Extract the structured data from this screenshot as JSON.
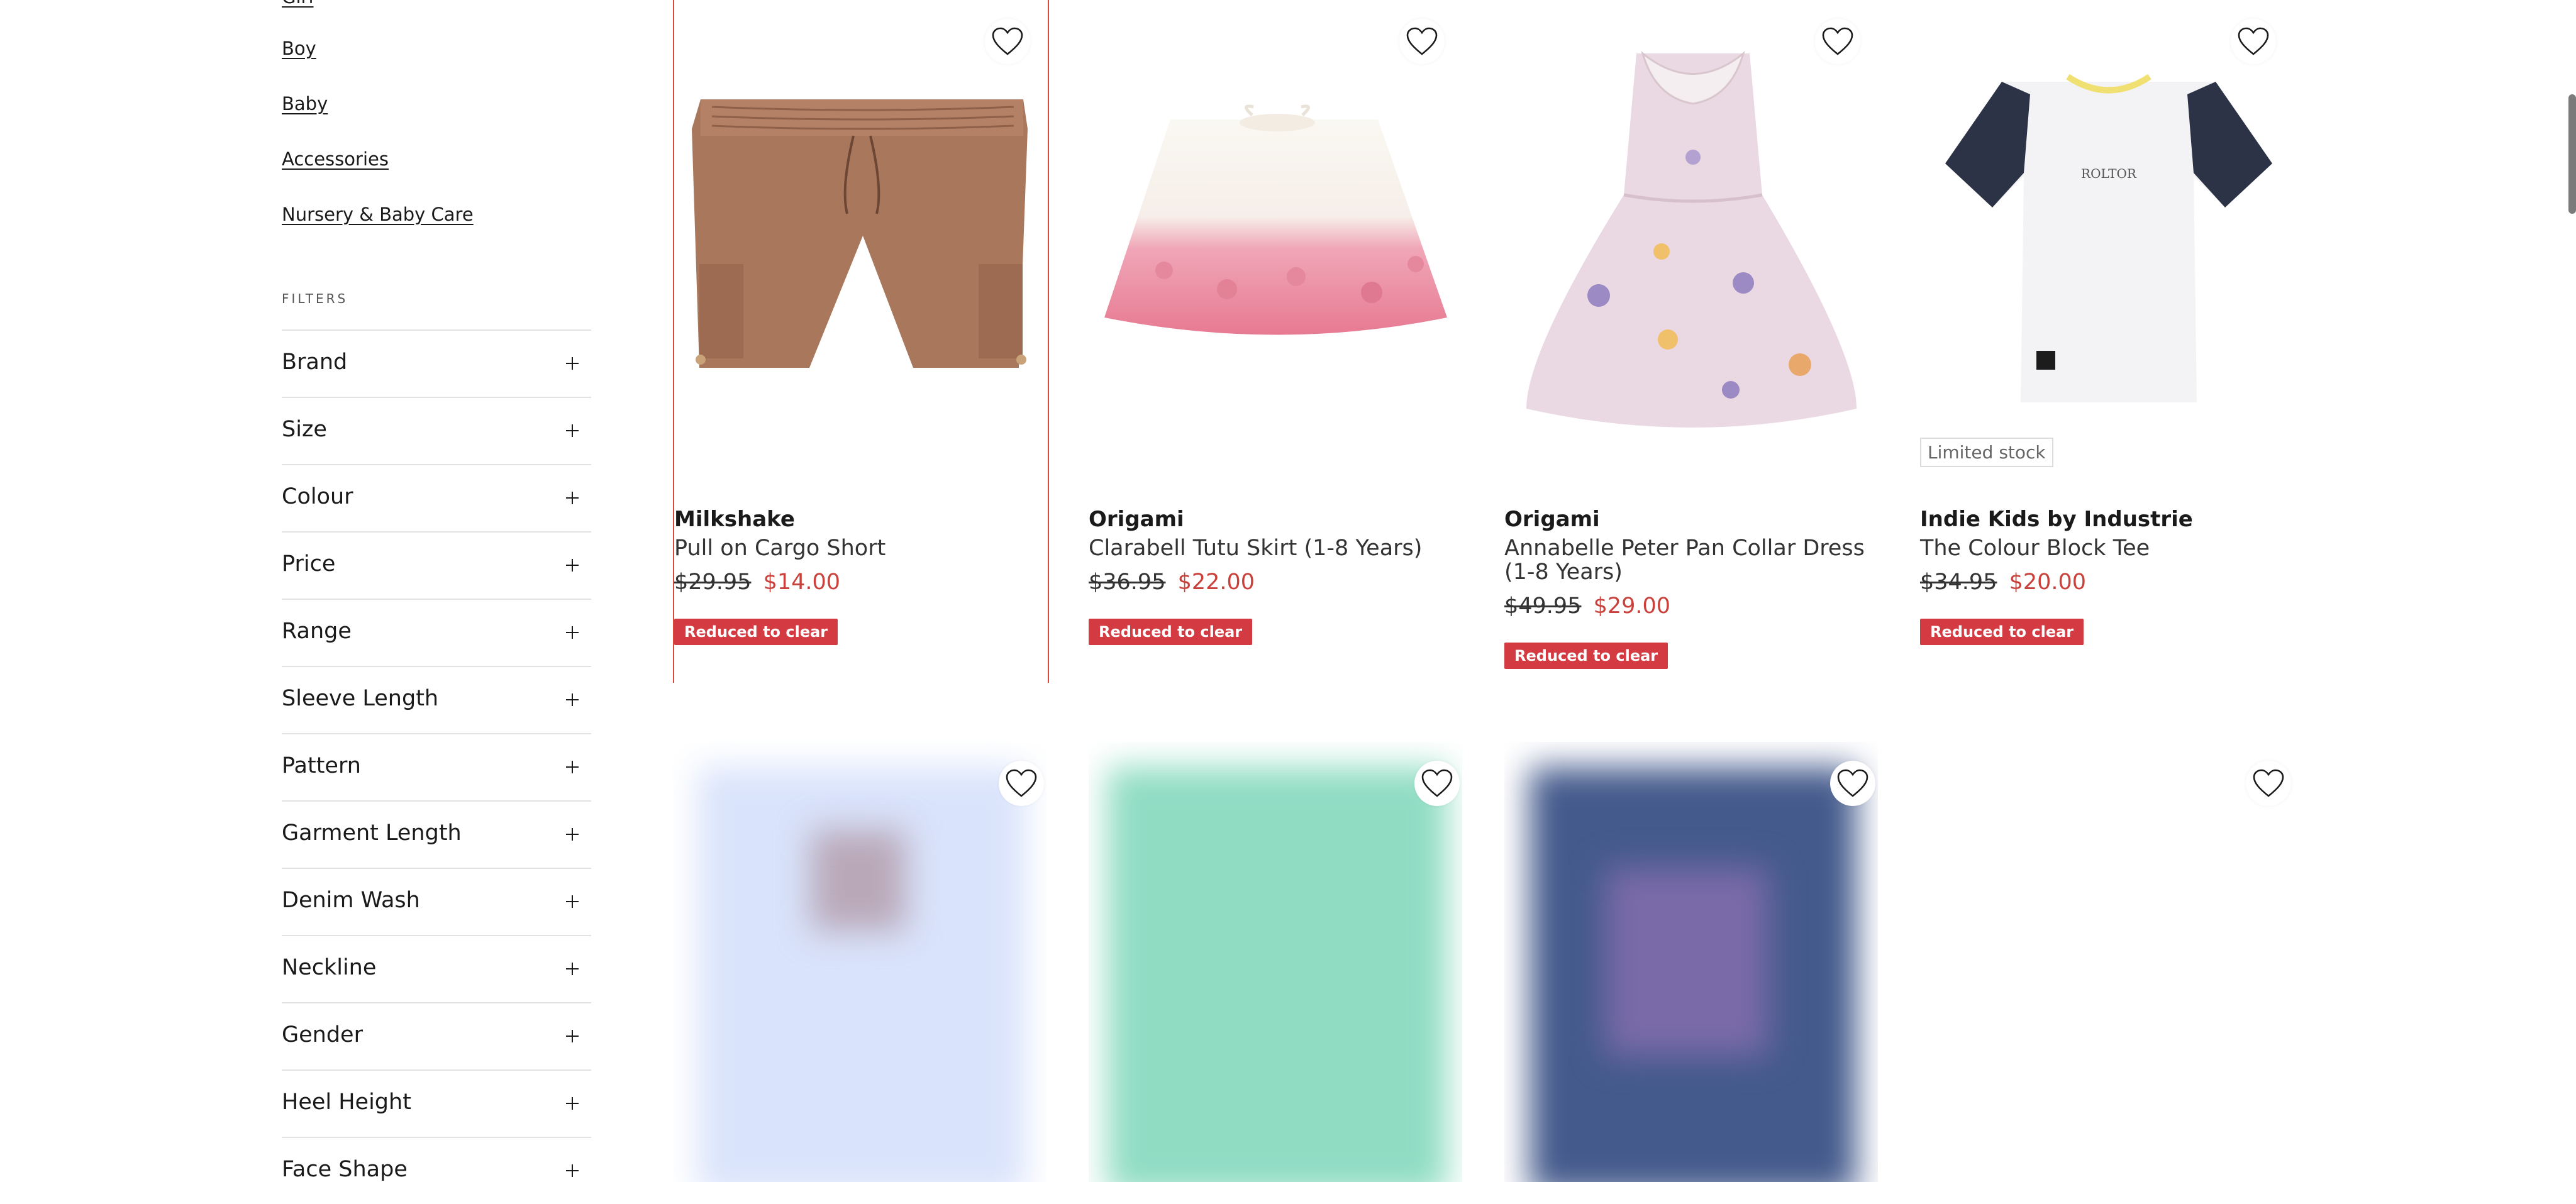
{
  "categories": [
    "Girl",
    "Boy",
    "Baby",
    "Accessories",
    "Nursery & Baby Care"
  ],
  "filters_heading": "FILTERS",
  "filters": [
    "Brand",
    "Size",
    "Colour",
    "Price",
    "Range",
    "Sleeve Length",
    "Pattern",
    "Garment Length",
    "Denim Wash",
    "Neckline",
    "Gender",
    "Heel Height",
    "Face Shape"
  ],
  "products": [
    {
      "brand": "Milkshake",
      "name": "Pull on Cargo Short",
      "old_price": "$29.95",
      "new_price": "$14.00",
      "badge": "Reduced to clear",
      "image": "brown-cargo-shorts"
    },
    {
      "brand": "Origami",
      "name": "Clarabell Tutu Skirt (1-8 Years)",
      "old_price": "$36.95",
      "new_price": "$22.00",
      "badge": "Reduced to clear",
      "image": "pink-tutu-skirt"
    },
    {
      "brand": "Origami",
      "name": "Annabelle Peter Pan Collar Dress (1-8 Years)",
      "old_price": "$49.95",
      "new_price": "$29.00",
      "badge": "Reduced to clear",
      "image": "floral-collar-dress"
    },
    {
      "brand": "Indie Kids by Industrie",
      "name": "The Colour Block Tee",
      "old_price": "$34.95",
      "new_price": "$20.00",
      "badge": "Reduced to clear",
      "stock_tag": "Limited stock",
      "image": "colour-block-tee",
      "tee_print": "ROLTOR"
    }
  ],
  "icons": {
    "wishlist": "heart-outline-icon",
    "expand": "plus-icon"
  },
  "colors": {
    "sale_red": "#c9413a",
    "badge_red": "#d33a41",
    "selected_outline": "#e0473c"
  }
}
